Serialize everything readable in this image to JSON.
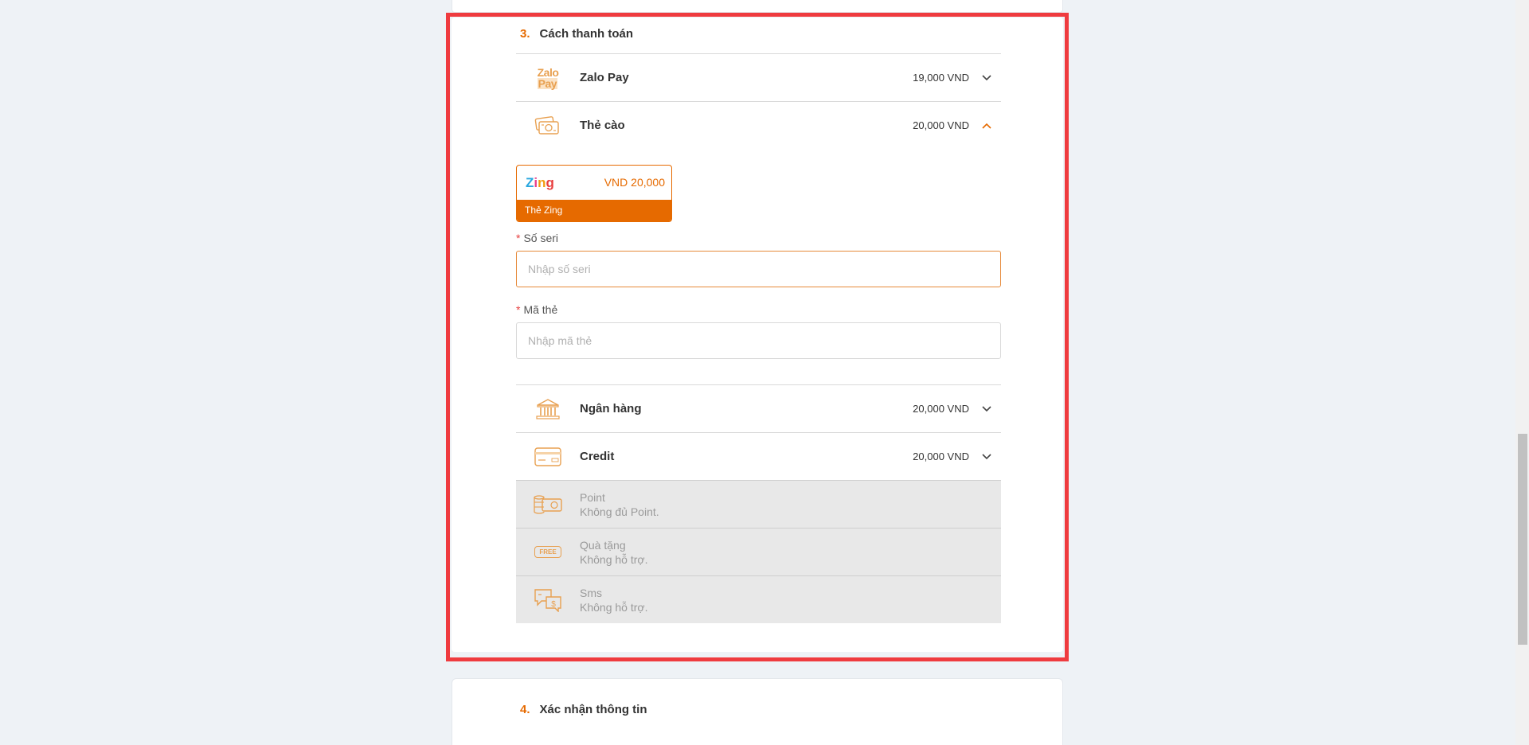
{
  "section3": {
    "number": "3.",
    "title": "Cách thanh toán"
  },
  "section4": {
    "number": "4.",
    "title": "Xác nhận thông tin"
  },
  "methods": [
    {
      "name": "Zalo Pay",
      "price": "19,000 VND",
      "icon": "zalopay-icon",
      "expanded": false
    },
    {
      "name": "Thẻ cào",
      "price": "20,000 VND",
      "icon": "cash-card-icon",
      "expanded": true
    },
    {
      "name": "Ngân hàng",
      "price": "20,000 VND",
      "icon": "bank-icon",
      "expanded": false
    },
    {
      "name": "Credit",
      "price": "20,000 VND",
      "icon": "credit-card-icon",
      "expanded": false
    }
  ],
  "zalo_logo": {
    "line1": "Zalo",
    "line2": "Pay"
  },
  "scratch_card": {
    "logo": "Zing",
    "amount": "VND 20,000",
    "label": "Thẻ Zing",
    "serial": {
      "label": "Số seri",
      "placeholder": "Nhập số seri",
      "value": ""
    },
    "code": {
      "label": "Mã thẻ",
      "placeholder": "Nhập mã thẻ",
      "value": ""
    },
    "required_mark": "*"
  },
  "disabled_methods": [
    {
      "name": "Point",
      "note": "Không đủ Point.",
      "icon": "coins-icon"
    },
    {
      "name": "Quà tặng",
      "note": "Không hỗ trợ.",
      "icon": "free-gift-icon",
      "icon_text": "FREE"
    },
    {
      "name": "Sms",
      "note": "Không hỗ trợ.",
      "icon": "sms-icon"
    }
  ],
  "colors": {
    "accent": "#e66a00",
    "highlight": "#ef3b3f",
    "disabled_bg": "#e8e8e8"
  }
}
